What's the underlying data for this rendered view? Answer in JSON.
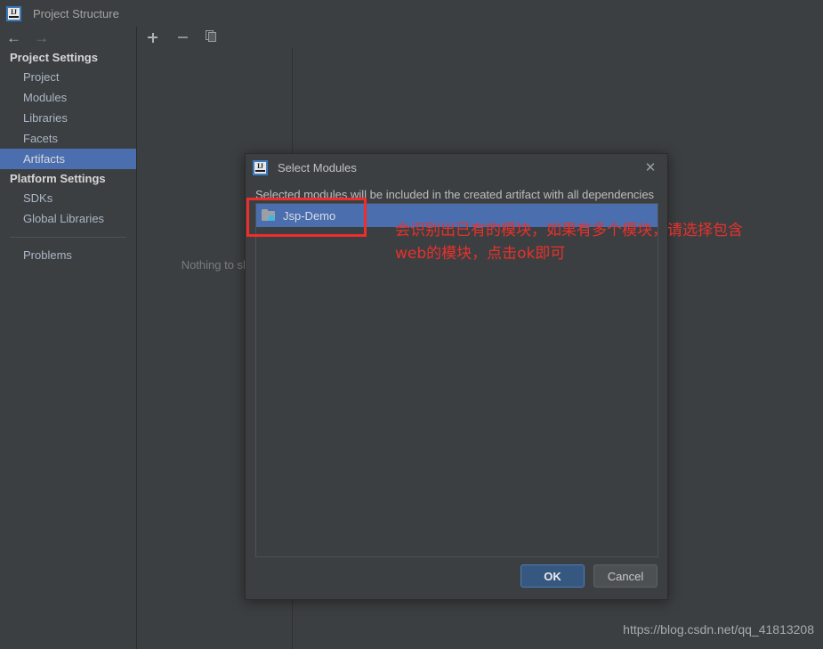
{
  "window": {
    "title": "Project Structure",
    "app_icon": "intellij-idea-logo-icon"
  },
  "navigation": {
    "back_icon": "arrow-left-icon",
    "forward_icon": "arrow-right-icon"
  },
  "sidebar": {
    "groups": [
      {
        "header": "Project Settings",
        "items": [
          {
            "label": "Project",
            "selected": false
          },
          {
            "label": "Modules",
            "selected": false
          },
          {
            "label": "Libraries",
            "selected": false
          },
          {
            "label": "Facets",
            "selected": false
          },
          {
            "label": "Artifacts",
            "selected": true
          }
        ]
      },
      {
        "header": "Platform Settings",
        "items": [
          {
            "label": "SDKs",
            "selected": false
          },
          {
            "label": "Global Libraries",
            "selected": false
          }
        ]
      }
    ],
    "problems_label": "Problems"
  },
  "content": {
    "toolbar": {
      "add_icon": "plus-icon",
      "remove_icon": "minus-icon",
      "copy_icon": "copy-icon"
    },
    "empty_text": "Nothing to sh"
  },
  "dialog": {
    "title": "Select Modules",
    "icon": "intellij-idea-logo-icon",
    "close_icon": "close-x-icon",
    "description": "Selected modules will be included in the created artifact with all dependencies",
    "modules": [
      {
        "name": "Jsp-Demo",
        "icon": "module-folder-icon",
        "selected": true
      }
    ],
    "ok_label": "OK",
    "cancel_label": "Cancel"
  },
  "annotation": {
    "line1": "会识别出已有的模块，如果有多个模块，请选择包含",
    "line2": "web的模块，点击ok即可",
    "color": "#e8312b"
  },
  "watermark": {
    "url": "https://blog.csdn.net/qq_41813208"
  },
  "colors": {
    "background": "#3c3f41",
    "selection_blue": "#4b6eaf",
    "primary_button": "#365880",
    "annotation_red": "#e8312b"
  }
}
